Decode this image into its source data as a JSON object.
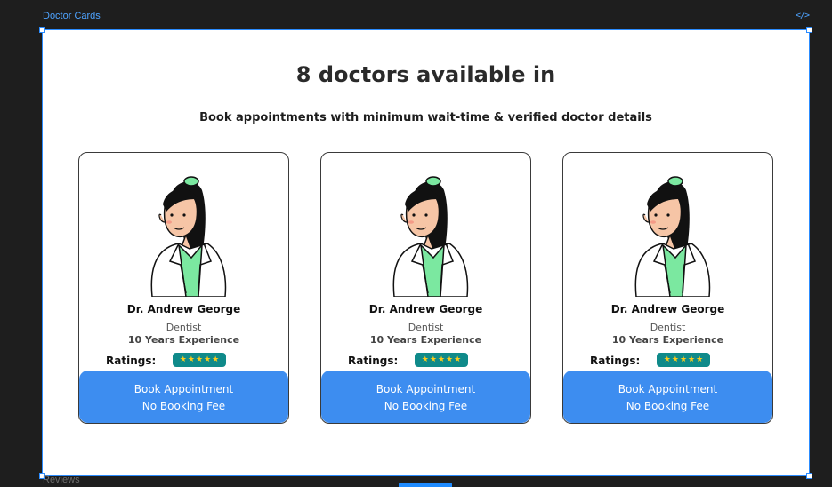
{
  "frame": {
    "label": "Doctor Cards",
    "code_icon": "</>"
  },
  "bottom_frame": {
    "label": "Reviews"
  },
  "heading": "8 doctors available in",
  "subheading": "Book appointments with minimum wait-time & verified doctor details",
  "cards": [
    {
      "name": "Dr. Andrew George",
      "specialty": "Dentist",
      "experience": "10 Years Experience",
      "ratings_label": "Ratings:",
      "rating": 5,
      "button_line1": "Book Appointment",
      "button_line2": "No Booking Fee"
    },
    {
      "name": "Dr. Andrew George",
      "specialty": "Dentist",
      "experience": "10 Years Experience",
      "ratings_label": "Ratings:",
      "rating": 5,
      "button_line1": "Book Appointment",
      "button_line2": "No Booking Fee"
    },
    {
      "name": "Dr. Andrew George",
      "specialty": "Dentist",
      "experience": "10 Years Experience",
      "ratings_label": "Ratings:",
      "rating": 5,
      "button_line1": "Book Appointment",
      "button_line2": "No Booking Fee"
    }
  ],
  "colors": {
    "accent": "#3d8df0",
    "rating_badge": "#0f8a8a",
    "star": "#ffcc1a",
    "scrub_green": "#7be8a0",
    "selection": "#2b8cff"
  },
  "icons": {
    "rating": "star-icon",
    "code": "code-icon",
    "doctor": "doctor-illustration"
  }
}
